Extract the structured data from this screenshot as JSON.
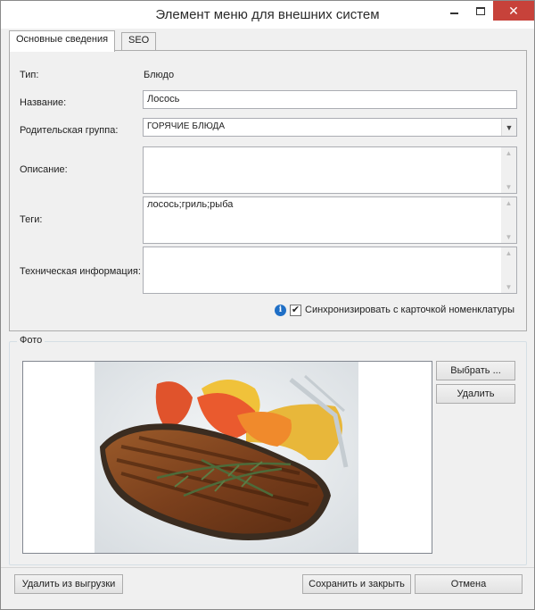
{
  "window": {
    "title": "Элемент меню для внешних систем"
  },
  "tabs": [
    {
      "label": "Основные сведения"
    },
    {
      "label": "SEO"
    }
  ],
  "form": {
    "type_label": "Тип:",
    "type_value": "Блюдо",
    "name_label": "Название:",
    "name_value": "Лосось",
    "parent_label": "Родительская группа:",
    "parent_value": "ГОРЯЧИЕ БЛЮДА",
    "description_label": "Описание:",
    "description_value": "",
    "tags_label": "Теги:",
    "tags_value": "лосось;гриль;рыба",
    "tech_label": "Техническая информация:",
    "tech_value": "",
    "sync_label": "Синхронизировать с карточкой номенклатуры",
    "sync_checked": true
  },
  "photo": {
    "group_title": "Фото",
    "select_label": "Выбрать ...",
    "delete_label": "Удалить"
  },
  "footer": {
    "remove_label": "Удалить из выгрузки",
    "save_label": "Сохранить и закрыть",
    "cancel_label": "Отмена"
  },
  "icons": {
    "minimize": "minimize-icon",
    "maximize": "maximize-icon",
    "close": "close-icon",
    "dropdown": "chevron-down-icon",
    "info": "info-icon",
    "checkbox": "checkmark-icon"
  }
}
